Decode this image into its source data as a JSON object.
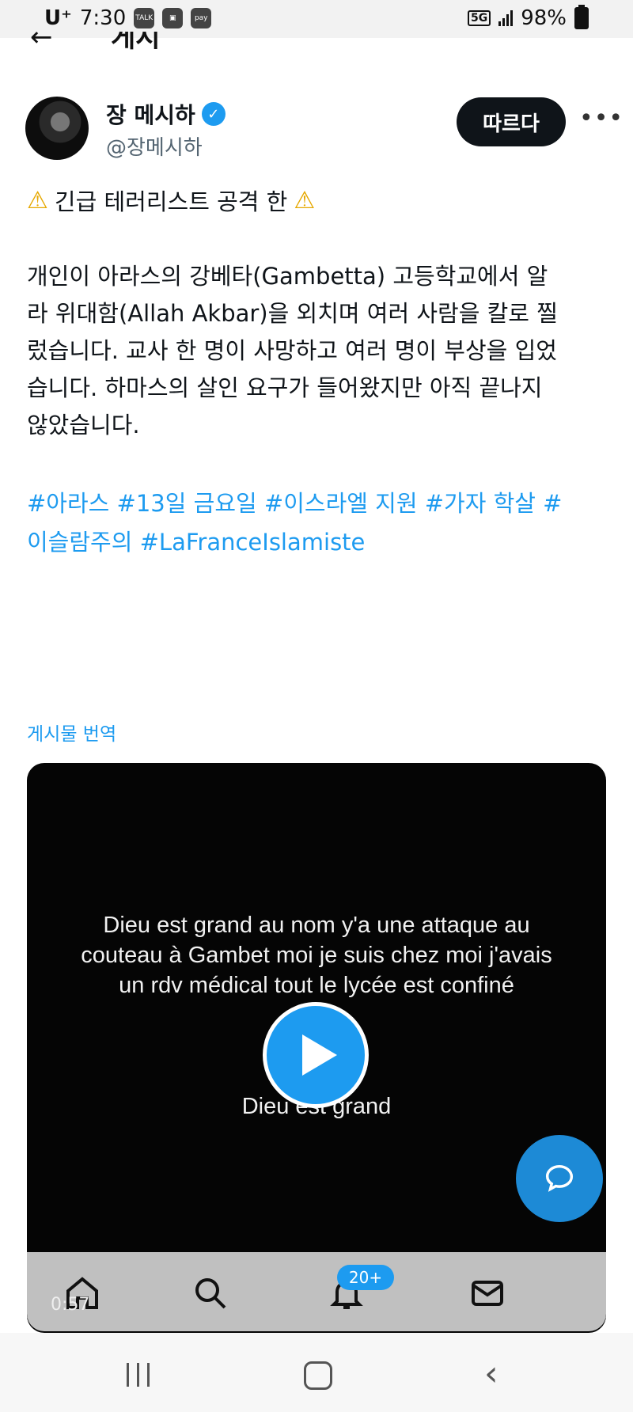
{
  "status_bar": {
    "carrier": "U⁺",
    "time": "7:30",
    "icons_left": [
      "kakaotalk-icon",
      "gallery-icon",
      "pay-icon"
    ],
    "network": "5G",
    "battery": "98%"
  },
  "header": {
    "back_icon": "arrow-left-icon",
    "title": "게시"
  },
  "author": {
    "name": "장 메시하",
    "handle": "@장메시하",
    "verified": true,
    "follow_label": "따르다",
    "more_label": "•••"
  },
  "tweet": {
    "headline": "긴급 테러리스트 공격 한",
    "body_lines": [
      "개인이 아라스의 강베타(Gambetta) 고등학교에서 알",
      "라 위대함(Allah Akbar)을 외치며 여러 사람을 칼로 찔",
      "렀습니다. 교사 한 명이 사망하고 여러 명이 부상을 입었",
      "습니다. 하마스의 살인 요구가 들어왔지만 아직 끝나지",
      "않았습니다."
    ],
    "hashtag_lines": [
      "#아라스 #13일 금요일 #이스라엘 지원 #가자 학살 #",
      "이슬람주의 #LaFranceIslamiste"
    ],
    "translate_label": "게시물 번역"
  },
  "video": {
    "caption_lines": [
      "Dieu est grand au nom y'a une attaque au",
      "couteau à Gambet moi je suis chez moi j'avais",
      "un rdv médical tout le lycée est confiné"
    ],
    "caption_bottom": "Dieu est grand",
    "timestamp": "0:57"
  },
  "tabbar": {
    "notifications_badge": "20+"
  },
  "colors": {
    "accent": "#1d9bf0",
    "follow_bg": "#0f1419",
    "video_bg": "#050505"
  }
}
